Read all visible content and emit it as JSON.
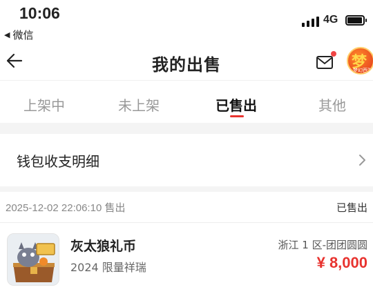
{
  "status_bar": {
    "time": "10:06",
    "back_app": "微信",
    "network": "4G"
  },
  "nav": {
    "title": "我的出售",
    "avatar_text": "梦",
    "avatar_sub": "梦幻西游"
  },
  "tabs": [
    {
      "label": "上架中",
      "active": false
    },
    {
      "label": "未上架",
      "active": false
    },
    {
      "label": "已售出",
      "active": true
    },
    {
      "label": "其他",
      "active": false
    }
  ],
  "wallet": {
    "label": "钱包收支明细"
  },
  "order": {
    "time": "2025-12-02 22:06:10 售出",
    "status": "已售出",
    "item_name": "灰太狼礼币",
    "item_desc": "2024 限量祥瑞",
    "server": "浙江 1 区-团团圆圆",
    "price": "¥ 8,000"
  },
  "colors": {
    "accent": "#e8332f",
    "muted_text": "#999999",
    "background": "#f4f4f4"
  },
  "icons": [
    "back-arrow-icon",
    "mail-icon",
    "chevron-right-icon",
    "signal-icon",
    "battery-icon"
  ]
}
